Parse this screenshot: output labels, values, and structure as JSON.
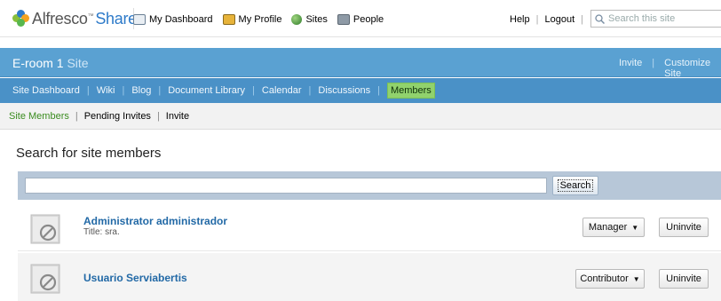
{
  "header": {
    "logo_word": "Alfresco",
    "logo_product": "Share",
    "nav": [
      {
        "label": "My Dashboard",
        "icon": "dashboard-icon"
      },
      {
        "label": "My Profile",
        "icon": "profile-icon"
      },
      {
        "label": "Sites",
        "icon": "sites-icon"
      },
      {
        "label": "People",
        "icon": "people-icon"
      }
    ],
    "help": "Help",
    "logout": "Logout",
    "search_placeholder": "Search this site"
  },
  "site": {
    "name": "E-room 1",
    "suffix": "Site",
    "actions": [
      "Invite",
      "Customize Site"
    ]
  },
  "site_nav": {
    "items": [
      "Site Dashboard",
      "Wiki",
      "Blog",
      "Document Library",
      "Calendar",
      "Discussions"
    ],
    "active": "Members"
  },
  "sub_nav": {
    "items": [
      "Site Members",
      "Pending Invites",
      "Invite"
    ]
  },
  "main": {
    "heading": "Search for site members",
    "search_button": "Search",
    "members": [
      {
        "name": "Administrator administrador",
        "title_label": "Title:",
        "title_value": "sra.",
        "role": "Manager",
        "action": "Uninvite"
      },
      {
        "name": "Usuario Serviabertis",
        "role": "Contributor",
        "action": "Uninvite"
      }
    ]
  },
  "colors": {
    "site_bar": "#5aa1d2",
    "site_nav": "#4a91c7",
    "active_tab": "#91d26d",
    "link": "#2269a6",
    "search_bar": "#b7c7d8"
  }
}
